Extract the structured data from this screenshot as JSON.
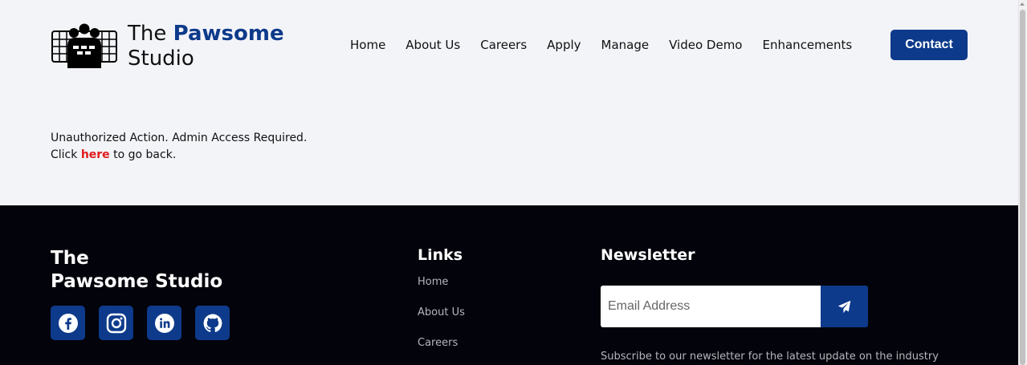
{
  "brand": {
    "line1": "The ",
    "highlight": "Pawsome",
    "line2": "Studio"
  },
  "nav": {
    "items": [
      "Home",
      "About Us",
      "Careers",
      "Apply",
      "Manage",
      "Video Demo",
      "Enhancements"
    ]
  },
  "header": {
    "contact_label": "Contact"
  },
  "message": {
    "line1": "Unauthorized Action. Admin Access Required.",
    "line2_prefix": "Click ",
    "link": "here",
    "line2_suffix": " to go back."
  },
  "footer": {
    "brand_line1": "The",
    "brand_line2": "Pawsome Studio",
    "social_icons": [
      "facebook-icon",
      "instagram-icon",
      "linkedin-icon",
      "github-icon"
    ],
    "links_title": "Links",
    "links": [
      "Home",
      "About Us",
      "Careers"
    ],
    "newsletter_title": "Newsletter",
    "email_placeholder": "Email Address",
    "newsletter_desc": "Subscribe to our newsletter for the latest update on the industry"
  },
  "colors": {
    "accent": "#0d3a8a",
    "link_red": "#e01b1b",
    "footer_bg": "#03030b",
    "page_bg": "#f3f4f8"
  }
}
